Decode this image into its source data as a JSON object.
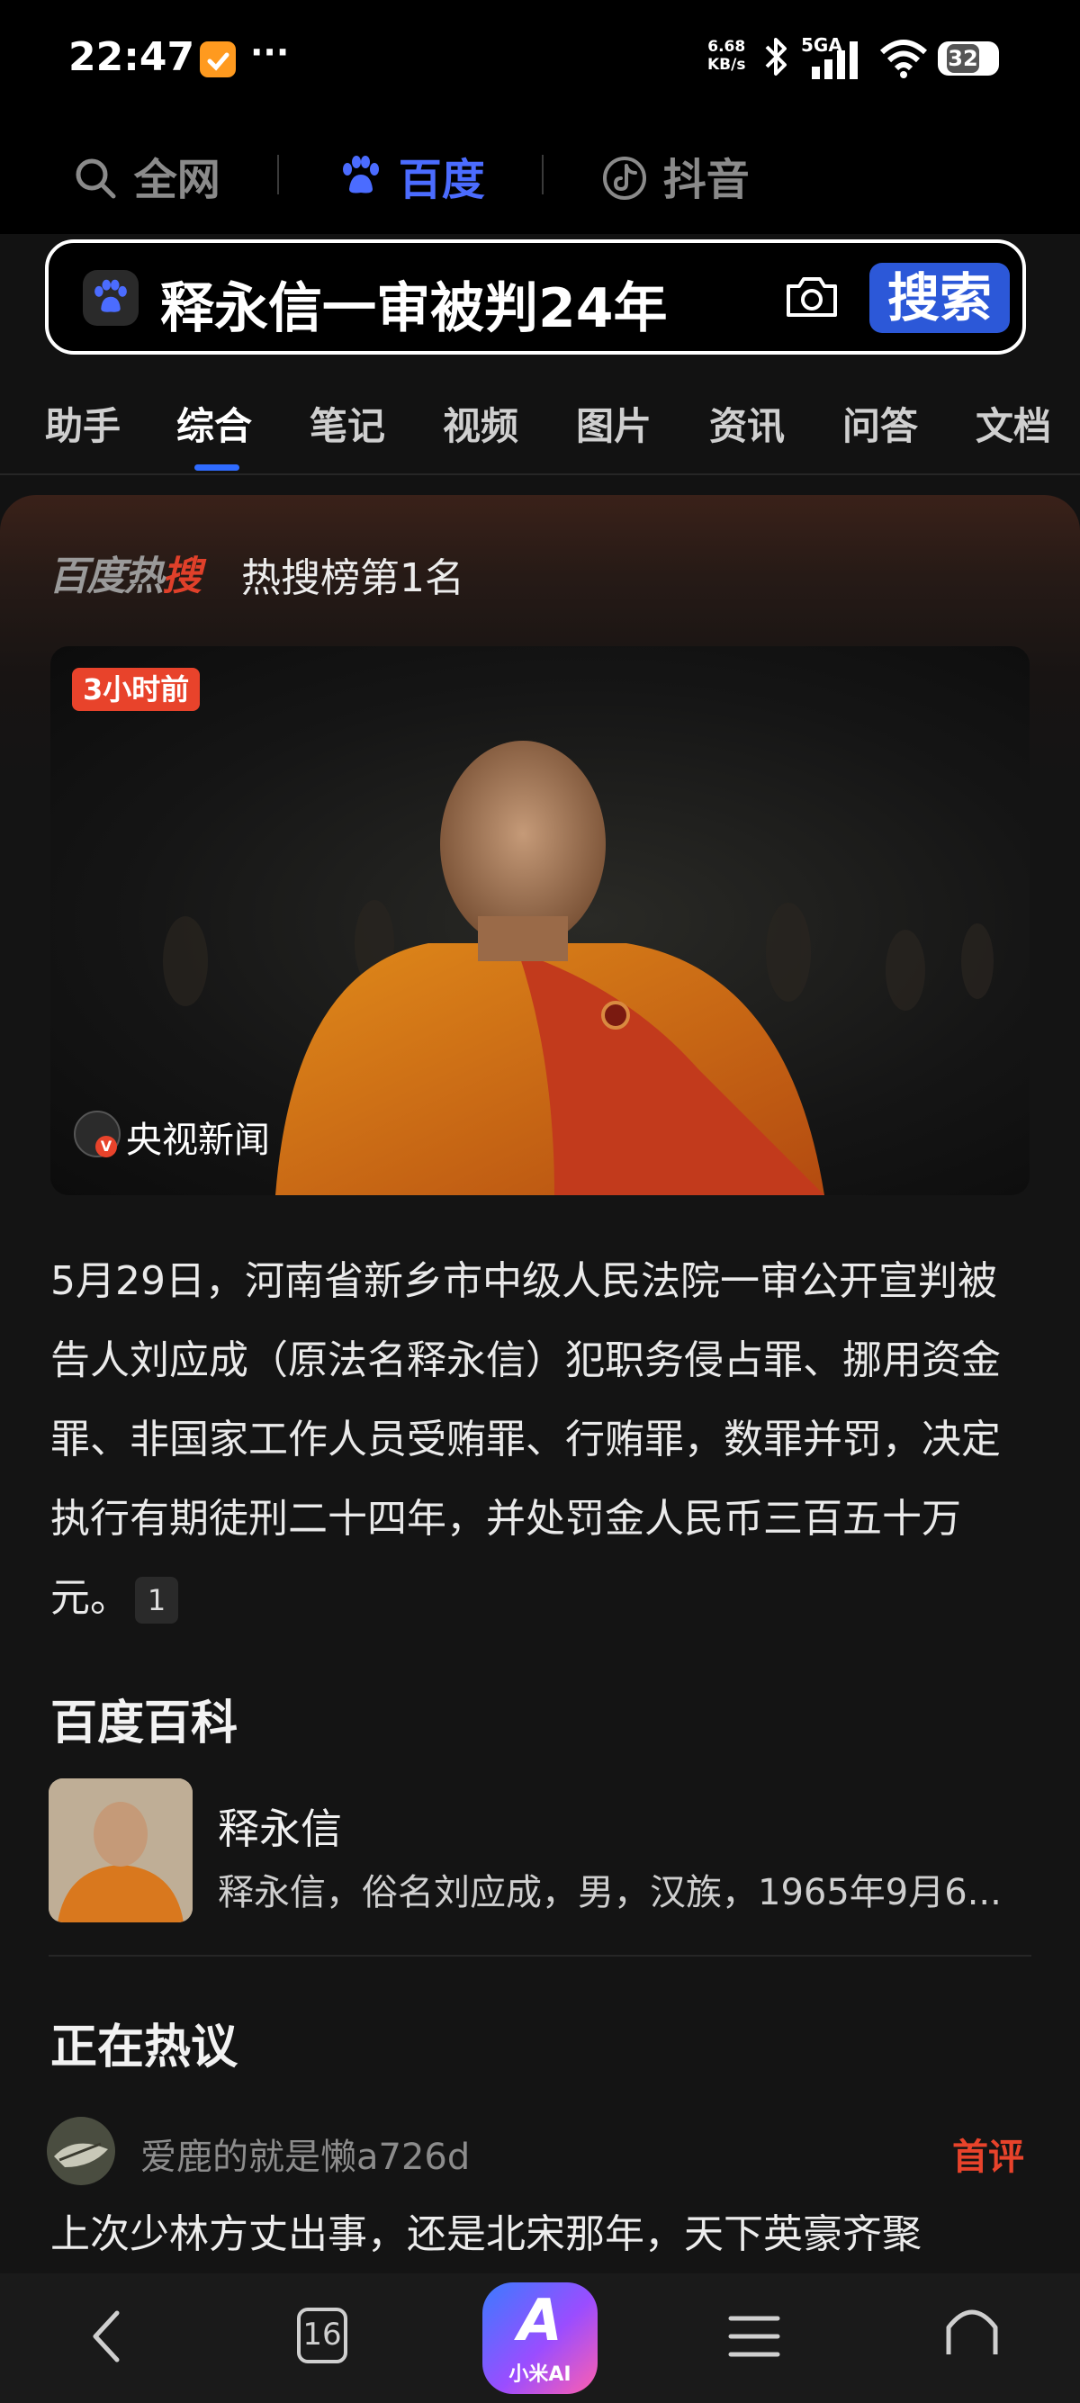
{
  "status_bar": {
    "time": "22:47",
    "more": "···",
    "net_speed_value": "6.68",
    "net_speed_unit": "KB/s",
    "network_label": "5GA",
    "battery": "32"
  },
  "engines": [
    {
      "label": "全网",
      "icon": "search-icon"
    },
    {
      "label": "百度",
      "icon": "paw-icon",
      "active": true
    },
    {
      "label": "抖音",
      "icon": "douyin-icon"
    }
  ],
  "search": {
    "query": "释永信一审被判24年",
    "button_label": "搜索"
  },
  "tabs": [
    "助手",
    "综合",
    "笔记",
    "视频",
    "图片",
    "资讯",
    "问答",
    "文档"
  ],
  "active_tab": "综合",
  "hot": {
    "logo_gray": "百度热",
    "logo_red": "搜",
    "rank": "热搜榜第1名",
    "time_badge": "3小时前",
    "source_logo": "央视\n新",
    "source": "央视新闻"
  },
  "summary": {
    "text": "5月29日，河南省新乡市中级人民法院一审公开宣判被告人刘应成（原法名释永信）犯职务侵占罪、挪用资金罪、非国家工作人员受贿罪、行贿罪，数罪并罚，决定执行有期徒刑二十四年，并处罚金人民币三百五十万元。",
    "citation": "1"
  },
  "baike": {
    "section_title": "百度百科",
    "name": "释永信",
    "desc": "释永信，俗名刘应成，男，汉族，1965年9月6..."
  },
  "discussion": {
    "section_title": "正在热议",
    "user": "爱鹿的就是懒a726d",
    "badge": "首评",
    "text": "上次少林方丈出事，还是北宋那年，天下英豪齐聚"
  },
  "bottom_nav": {
    "tabs_count": "16",
    "ai_label": "小米AI",
    "ai_letter": "A"
  },
  "colors": {
    "accent_blue": "#4b6cff",
    "search_button": "#2c58d8",
    "hot_red": "#e8432b"
  }
}
